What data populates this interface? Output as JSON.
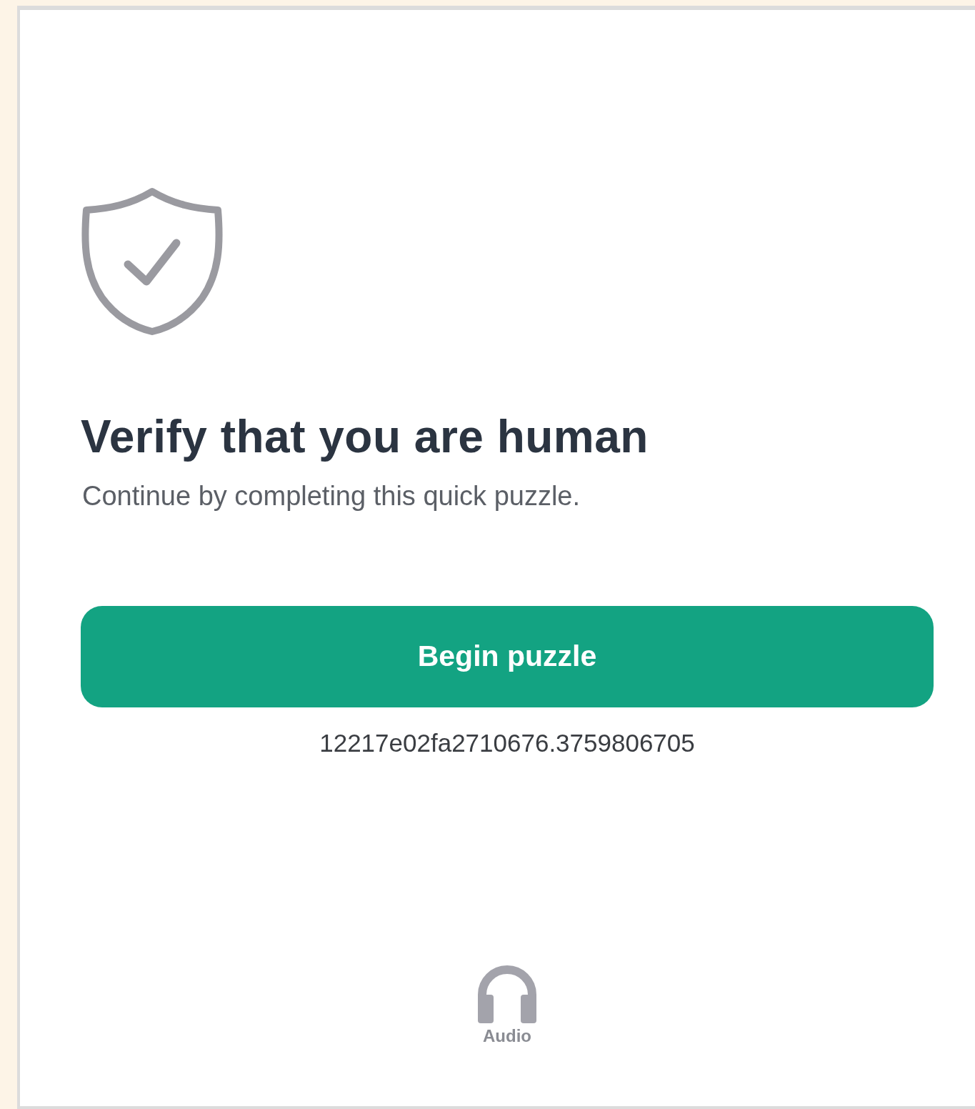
{
  "title": "Verify that you are human",
  "subtitle": "Continue by completing this quick puzzle.",
  "button": {
    "label": "Begin puzzle"
  },
  "session_id": "12217e02fa2710676.3759806705",
  "audio": {
    "label": "Audio"
  }
}
